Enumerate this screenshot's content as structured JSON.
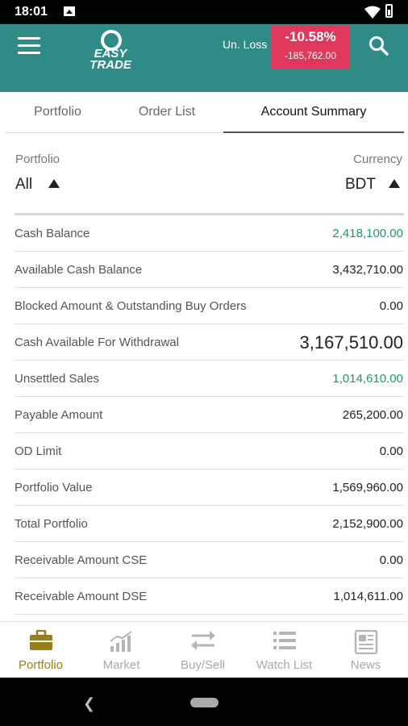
{
  "status_bar": {
    "time": "18:01"
  },
  "header": {
    "unrealized_label": "Un. Loss",
    "loss_percent": "-10.58%",
    "loss_amount": "-185,762.00",
    "accent": "#2e8b86",
    "loss_color": "#e0385a"
  },
  "tabs": [
    {
      "label": "Portfolio",
      "active": false
    },
    {
      "label": "Order List",
      "active": false
    },
    {
      "label": "Account Summary",
      "active": true
    }
  ],
  "filters": {
    "portfolio_label": "Portfolio",
    "portfolio_value": "All",
    "currency_label": "Currency",
    "currency_value": "BDT"
  },
  "summary_rows": [
    {
      "label": "Cash Balance",
      "value": "2,418,100.00",
      "style": "green"
    },
    {
      "label": "Available Cash Balance",
      "value": "3,432,710.00",
      "style": "normal"
    },
    {
      "label": "Blocked Amount & Outstanding Buy Orders",
      "value": "0.00",
      "style": "normal"
    },
    {
      "label": "Cash Available For Withdrawal",
      "value": "3,167,510.00",
      "style": "big"
    },
    {
      "label": "Unsettled Sales",
      "value": "1,014,610.00",
      "style": "green"
    },
    {
      "label": "Payable Amount",
      "value": "265,200.00",
      "style": "normal"
    },
    {
      "label": "OD Limit",
      "value": "0.00",
      "style": "normal"
    },
    {
      "label": "Portfolio Value",
      "value": "1,569,960.00",
      "style": "normal"
    },
    {
      "label": "Total Portfolio",
      "value": "2,152,900.00",
      "style": "normal"
    },
    {
      "label": "Receivable Amount CSE",
      "value": "0.00",
      "style": "normal"
    },
    {
      "label": "Receivable Amount DSE",
      "value": "1,014,611.00",
      "style": "normal"
    }
  ],
  "bottom_nav": [
    {
      "label": "Portfolio",
      "icon": "briefcase-icon",
      "active": true
    },
    {
      "label": "Market",
      "icon": "bar-chart-icon",
      "active": false
    },
    {
      "label": "Buy/Sell",
      "icon": "swap-arrows-icon",
      "active": false
    },
    {
      "label": "Watch List",
      "icon": "list-icon",
      "active": false
    },
    {
      "label": "News",
      "icon": "newspaper-icon",
      "active": false
    }
  ]
}
